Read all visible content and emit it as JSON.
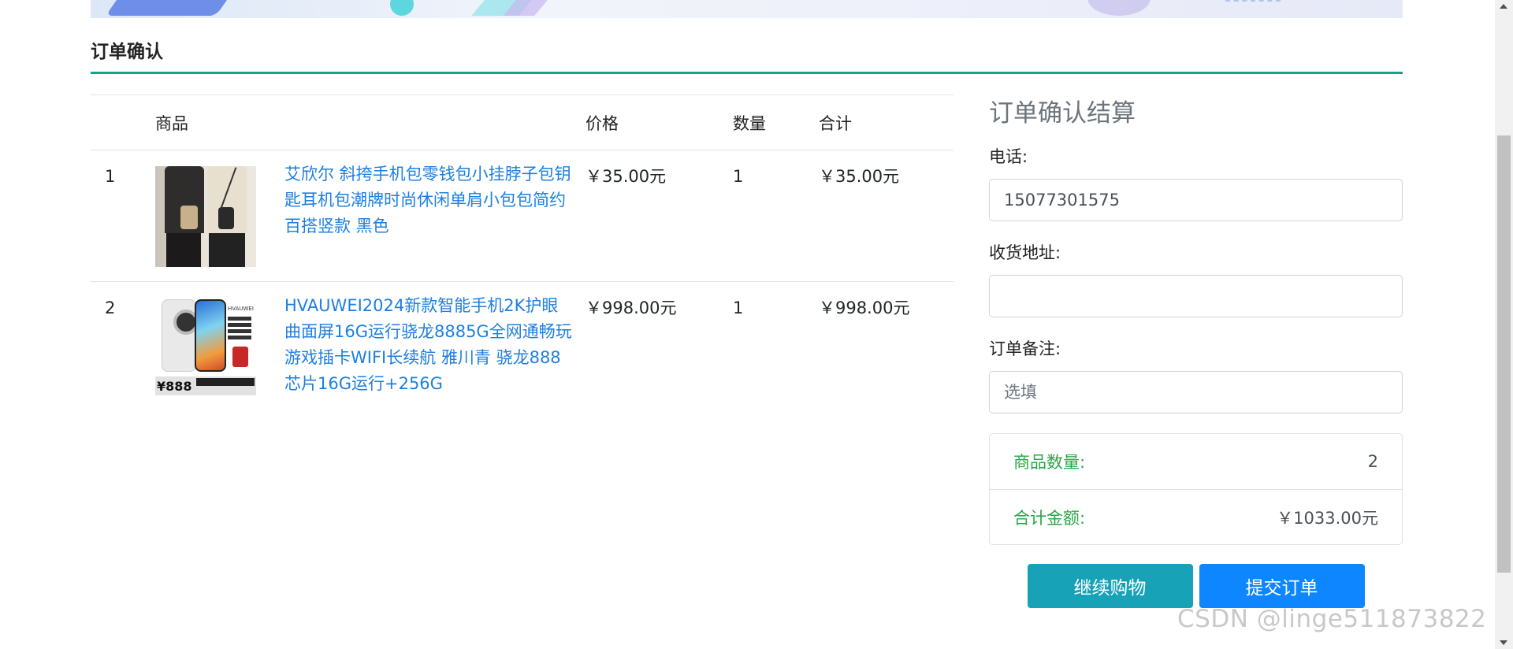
{
  "page": {
    "title": "订单确认"
  },
  "table": {
    "headers": [
      "商品",
      "价格",
      "数量",
      "合计"
    ],
    "rows": [
      {
        "index": "1",
        "name": "艾欣尔 斜挎手机包零钱包小挂脖子包钥匙耳机包潮牌时尚休闲单肩小包包简约百搭竖款 黑色",
        "price": "￥35.00元",
        "qty": "1",
        "subtotal": "￥35.00元",
        "image": "bag-product-image"
      },
      {
        "index": "2",
        "name": "HVAUWEI2024新款智能手机2K护眼曲面屏16G运行骁龙8885G全网通畅玩游戏插卡WIFI长续航 雅川青 骁龙888芯片16G运行+256G",
        "price": "￥998.00元",
        "qty": "1",
        "subtotal": "￥998.00元",
        "image": "phone-product-image"
      }
    ]
  },
  "checkout": {
    "title": "订单确认结算",
    "phone_label": "电话:",
    "phone_value": "15077301575",
    "address_label": "收货地址:",
    "address_value": "",
    "note_label": "订单备注:",
    "note_placeholder": "选填",
    "count_label": "商品数量:",
    "count_value": "2",
    "total_label": "合计金额:",
    "total_value": "￥1033.00元",
    "continue_button": "继续购物",
    "submit_button": "提交订单"
  },
  "product_images": {
    "phone_brand": "HVAUWEI",
    "phone_price": "¥888"
  },
  "watermark": "CSDN @linge511873822",
  "colors": {
    "accent_underline": "#1aa085",
    "link": "#1e7fe0",
    "summary_label": "#28a745",
    "continue_button": "#17a2b8",
    "submit_button": "#0d86ff"
  }
}
